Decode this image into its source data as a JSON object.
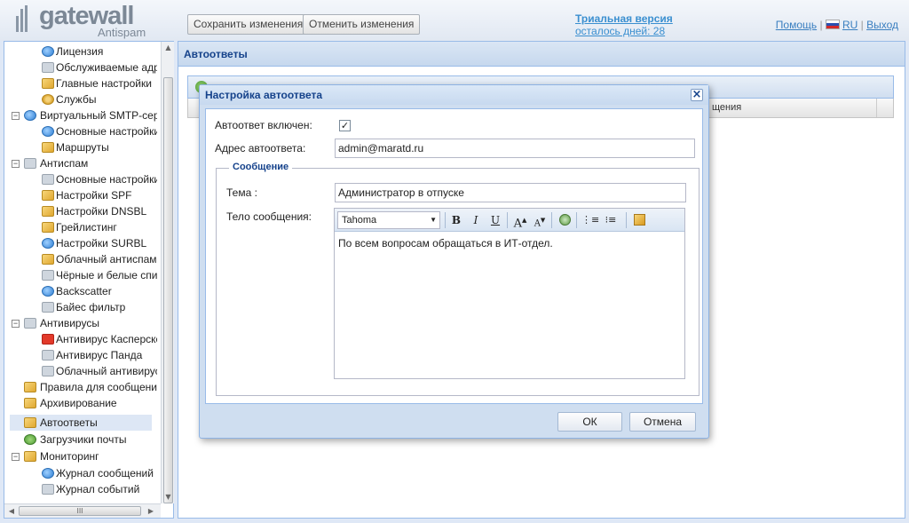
{
  "header": {
    "logo_text": "gatewall",
    "logo_sub": "Antispam",
    "save_button": "Сохранить изменения",
    "cancel_button": "Отменить изменения",
    "trial_title": "Триальная версия",
    "trial_days": "осталось дней: 28",
    "help_link": "Помощь",
    "language": "RU",
    "logout_link": "Выход"
  },
  "tree": {
    "items": [
      {
        "label": "Лицензия",
        "icon": "license-icon"
      },
      {
        "label": "Обслуживаемые адреса",
        "icon": "addresses-icon"
      },
      {
        "label": "Главные настройки",
        "icon": "settings-icon"
      },
      {
        "label": "Службы",
        "icon": "services-icon"
      },
      {
        "label": "Виртуальный SMTP-сервер",
        "icon": "smtp-icon",
        "toggle": "−"
      },
      {
        "label": "Основные настройки",
        "icon": "smtp-settings-icon"
      },
      {
        "label": "Маршруты",
        "icon": "routes-icon"
      },
      {
        "label": "Антиспам",
        "icon": "antispam-icon",
        "toggle": "−"
      },
      {
        "label": "Основные настройки",
        "icon": "antispam-settings-icon"
      },
      {
        "label": "Настройки SPF",
        "icon": "spf-icon"
      },
      {
        "label": "Настройки DNSBL",
        "icon": "dnsbl-icon"
      },
      {
        "label": "Грейлистинг",
        "icon": "greylisting-icon"
      },
      {
        "label": "Настройки SURBL",
        "icon": "surbl-icon"
      },
      {
        "label": "Облачный антиспам",
        "icon": "cloud-antispam-icon"
      },
      {
        "label": "Чёрные и белые списки",
        "icon": "lists-icon"
      },
      {
        "label": "Backscatter",
        "icon": "backscatter-icon"
      },
      {
        "label": "Байес фильтр",
        "icon": "bayes-icon"
      },
      {
        "label": "Антивирусы",
        "icon": "antivirus-icon",
        "toggle": "−"
      },
      {
        "label": "Антивирус Касперского",
        "icon": "kaspersky-icon"
      },
      {
        "label": "Антивирус Панда",
        "icon": "panda-icon"
      },
      {
        "label": "Облачный антивирус",
        "icon": "cloud-antivirus-icon"
      },
      {
        "label": "Правила для сообщений",
        "icon": "rules-icon"
      },
      {
        "label": "Архивирование",
        "icon": "archive-icon"
      },
      {
        "label": "Автоответы",
        "icon": "autoreply-icon"
      },
      {
        "label": "Загрузчики почты",
        "icon": "mail-loaders-icon"
      },
      {
        "label": "Мониторинг",
        "icon": "monitoring-icon",
        "toggle": "−"
      },
      {
        "label": "Журнал сообщений",
        "icon": "message-log-icon"
      },
      {
        "label": "Журнал событий",
        "icon": "event-log-icon"
      }
    ],
    "scroll_thumb_glyph": "III"
  },
  "main": {
    "title": "Автоответы",
    "column_fragment": "щения"
  },
  "dialog": {
    "title": "Настройка автоответа",
    "enabled_label": "Автоответ включен:",
    "enabled_checked": true,
    "address_label": "Адрес автоответа:",
    "address_value": "admin@maratd.ru",
    "fieldset_legend": "Сообщение",
    "subject_label": "Тема :",
    "subject_value": "Администратор в отпуске",
    "body_label": "Тело сообщения:",
    "font_value": "Tahoma",
    "body_text": "По всем вопросам обращаться в ИТ-отдел.",
    "ok_button": "ОК",
    "cancel_button": "Отмена"
  }
}
